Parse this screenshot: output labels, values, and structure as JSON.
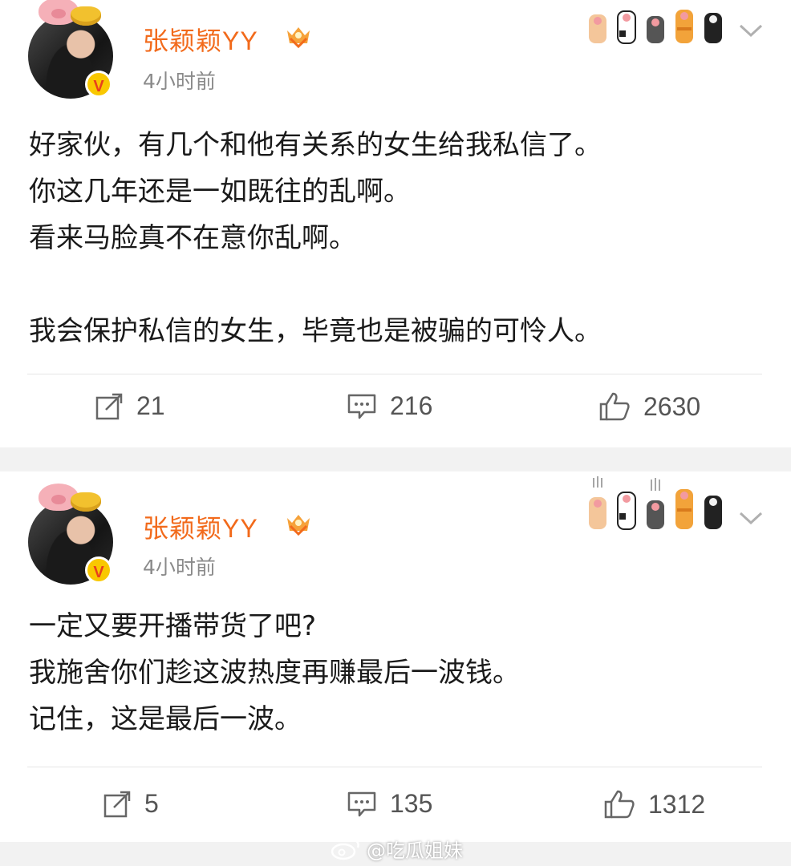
{
  "posts": [
    {
      "username": "张颖颖YY",
      "time": "4小时前",
      "lines": [
        "好家伙，有几个和他有关系的女生给我私信了。",
        "你这几年还是一如既往的乱啊。",
        "看来马脸真不在意你乱啊。",
        "",
        "我会保护私信的女生，毕竟也是被骗的可怜人。"
      ],
      "repost_count": "21",
      "comment_count": "216",
      "like_count": "2630"
    },
    {
      "username": "张颖颖YY",
      "time": "4小时前",
      "lines": [
        "一定又要开播带货了吧?",
        "我施舍你们趁这波热度再赚最后一波钱。",
        "记住，这是最后一波。"
      ],
      "repost_count": "5",
      "comment_count": "135",
      "like_count": "1312"
    }
  ],
  "verified_badge": "V",
  "watermark": "@吃瓜姐妹",
  "colors": {
    "username": "#f26a1b",
    "timestamp": "#8a8a8a",
    "separator": "#f2f2f2",
    "verified": "#f9c800"
  },
  "icons": [
    "repost-icon",
    "comment-icon",
    "like-icon",
    "chevron-down-icon",
    "paw-decoration-icon",
    "vip-crown-icon",
    "weibo-logo-icon"
  ]
}
